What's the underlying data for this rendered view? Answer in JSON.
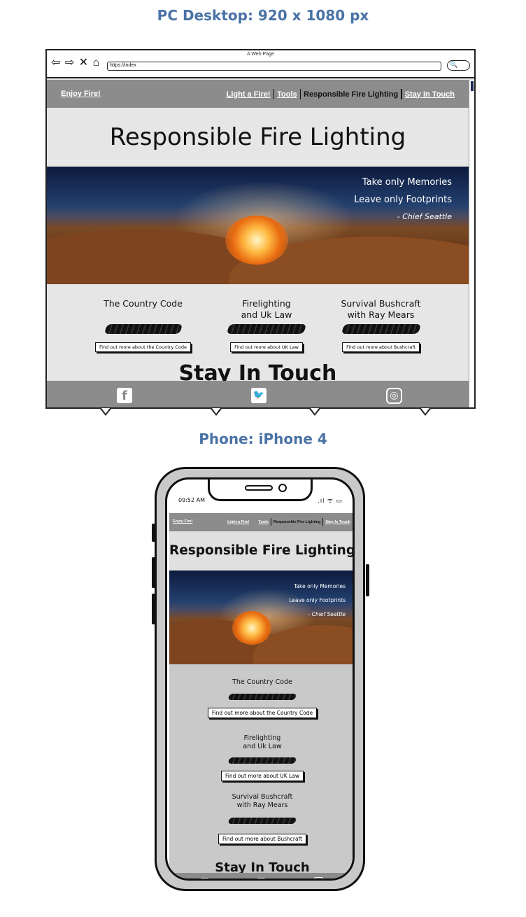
{
  "labels": {
    "desktop": "PC Desktop: 920 x 1080 px",
    "phone": "Phone: iPhone 4"
  },
  "browser": {
    "window_title": "A Web Page",
    "url": "https://index",
    "nav_glyphs": "⇦ ⇨ ✕ ⌂",
    "search_glyph": "🔍"
  },
  "nav": {
    "brand": "Enjoy Fire!",
    "links": [
      {
        "label": "Light a Fire!",
        "active": false
      },
      {
        "label": "Tools",
        "active": false
      },
      {
        "label": "Responsible Fire Lighting",
        "active": true
      },
      {
        "label": "Stay In Touch",
        "active": false
      }
    ]
  },
  "page": {
    "heading": "Responsible Fire Lighting",
    "quote_line1": "Take only Memories",
    "quote_line2": "Leave only Footprints",
    "quote_attribution": "- Chief Seattle"
  },
  "cards": [
    {
      "title_line1": "The Country Code",
      "title_line2": "",
      "button": "Find out more about the Country Code"
    },
    {
      "title_line1": "Firelighting",
      "title_line2": "and Uk Law",
      "button": "Find out more about UK Law"
    },
    {
      "title_line1": "Survival Bushcraft",
      "title_line2": "with Ray Mears",
      "button": "Find out more about Bushcraft"
    }
  ],
  "stay_in_touch": "Stay In Touch",
  "social": {
    "facebook": "f",
    "twitter": "🐦",
    "instagram": "◎"
  },
  "phone_status": {
    "time": "09:52 AM",
    "icons": ".ıl ᯤ ▭"
  },
  "colors": {
    "label_blue": "#4a72a6",
    "nav_grey": "#8c8c8c",
    "page_grey": "#e6e6e6",
    "phone_bg": "#c9c9c9"
  }
}
